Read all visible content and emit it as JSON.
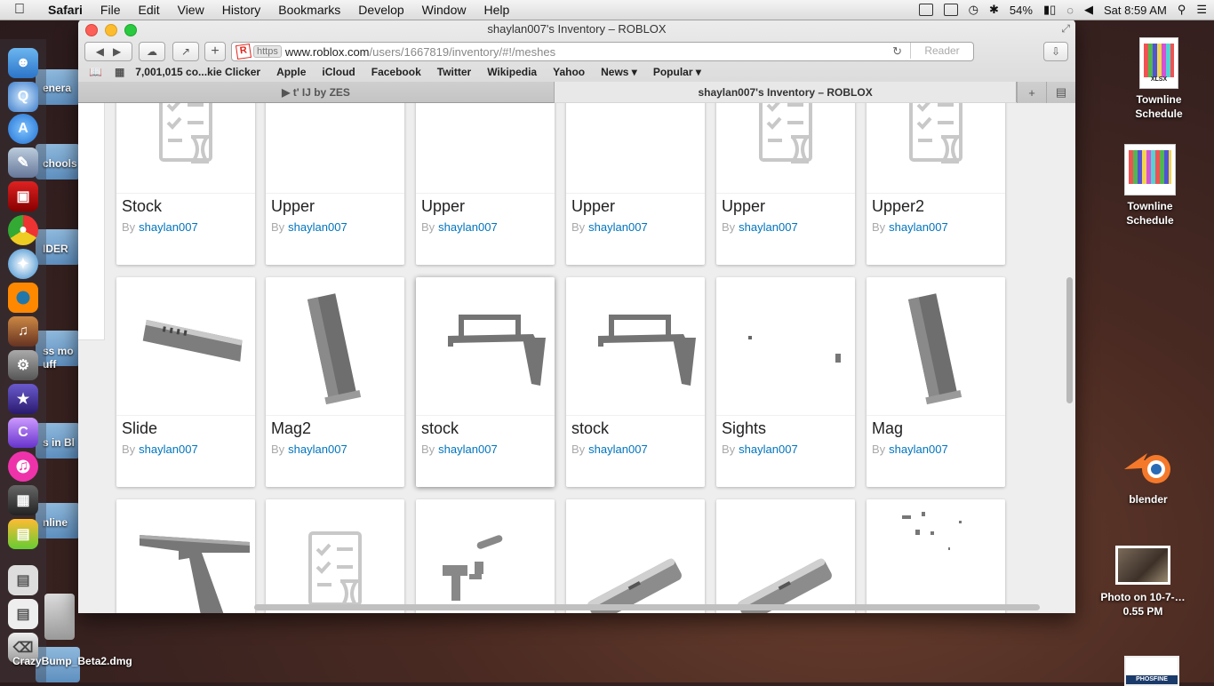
{
  "menubar": {
    "app": "Safari",
    "items": [
      "File",
      "Edit",
      "View",
      "History",
      "Bookmarks",
      "Develop",
      "Window",
      "Help"
    ],
    "status": {
      "battery": "54%",
      "clock": "Sat 8:59 AM"
    }
  },
  "window": {
    "title": "shaylan007's Inventory – ROBLOX",
    "url": {
      "scheme": "https",
      "host": "www.roblox.com",
      "path": "/users/1667819/inventory/#!/meshes"
    },
    "reader_label": "Reader",
    "bookmarks": [
      "7,001,015 co...kie Clicker",
      "Apple",
      "iCloud",
      "Facebook",
      "Twitter",
      "Wikipedia",
      "Yahoo",
      "News ▾",
      "Popular ▾"
    ],
    "tabs": [
      {
        "label": "▶ t' IJ by ZES"
      },
      {
        "label": "shaylan007's Inventory – ROBLOX"
      }
    ]
  },
  "inventory": {
    "by_prefix": "By",
    "creator": "shaylan007",
    "rows": [
      [
        {
          "name": "Stock",
          "thumb": "placeholder-icon"
        },
        {
          "name": "Upper",
          "thumb": "barrel-mesh"
        },
        {
          "name": "Upper",
          "thumb": "barrel-mesh"
        },
        {
          "name": "Upper",
          "thumb": "barrel-mesh"
        },
        {
          "name": "Upper",
          "thumb": "placeholder-icon"
        },
        {
          "name": "Upper2",
          "thumb": "placeholder-icon"
        }
      ],
      [
        {
          "name": "Slide",
          "thumb": "slide-mesh"
        },
        {
          "name": "Mag2",
          "thumb": "magazine-mesh"
        },
        {
          "name": "stock",
          "thumb": "stock-mesh"
        },
        {
          "name": "stock",
          "thumb": "stock-mesh"
        },
        {
          "name": "Sights",
          "thumb": "sights-mesh"
        },
        {
          "name": "Mag",
          "thumb": "magazine-mesh"
        }
      ],
      [
        {
          "name": "",
          "thumb": "frame-mesh"
        },
        {
          "name": "",
          "thumb": "placeholder-icon"
        },
        {
          "name": "",
          "thumb": "parts-mesh"
        },
        {
          "name": "",
          "thumb": "barrel-large-mesh"
        },
        {
          "name": "",
          "thumb": "barrel-large-mesh"
        },
        {
          "name": "",
          "thumb": "scatter-mesh"
        }
      ]
    ]
  },
  "desktop": {
    "folders": [
      "enera",
      "chools",
      "IDER",
      "ss mo",
      "uff",
      "s in Bl",
      "nline"
    ],
    "dmg_label": "CrazyBump_Beta2.dmg",
    "items": [
      {
        "label": "Townline Schedule",
        "type": "xlsx-icon",
        "tag": "XLSX"
      },
      {
        "label": "Townline Schedule",
        "type": "xlsx-icon",
        "tag": ""
      },
      {
        "label": "blender",
        "type": "blender-icon"
      },
      {
        "label": "Photo on 10-7-…0.55 PM",
        "type": "photo-icon"
      },
      {
        "label": "PHOSFINE",
        "type": "document-icon"
      }
    ]
  }
}
